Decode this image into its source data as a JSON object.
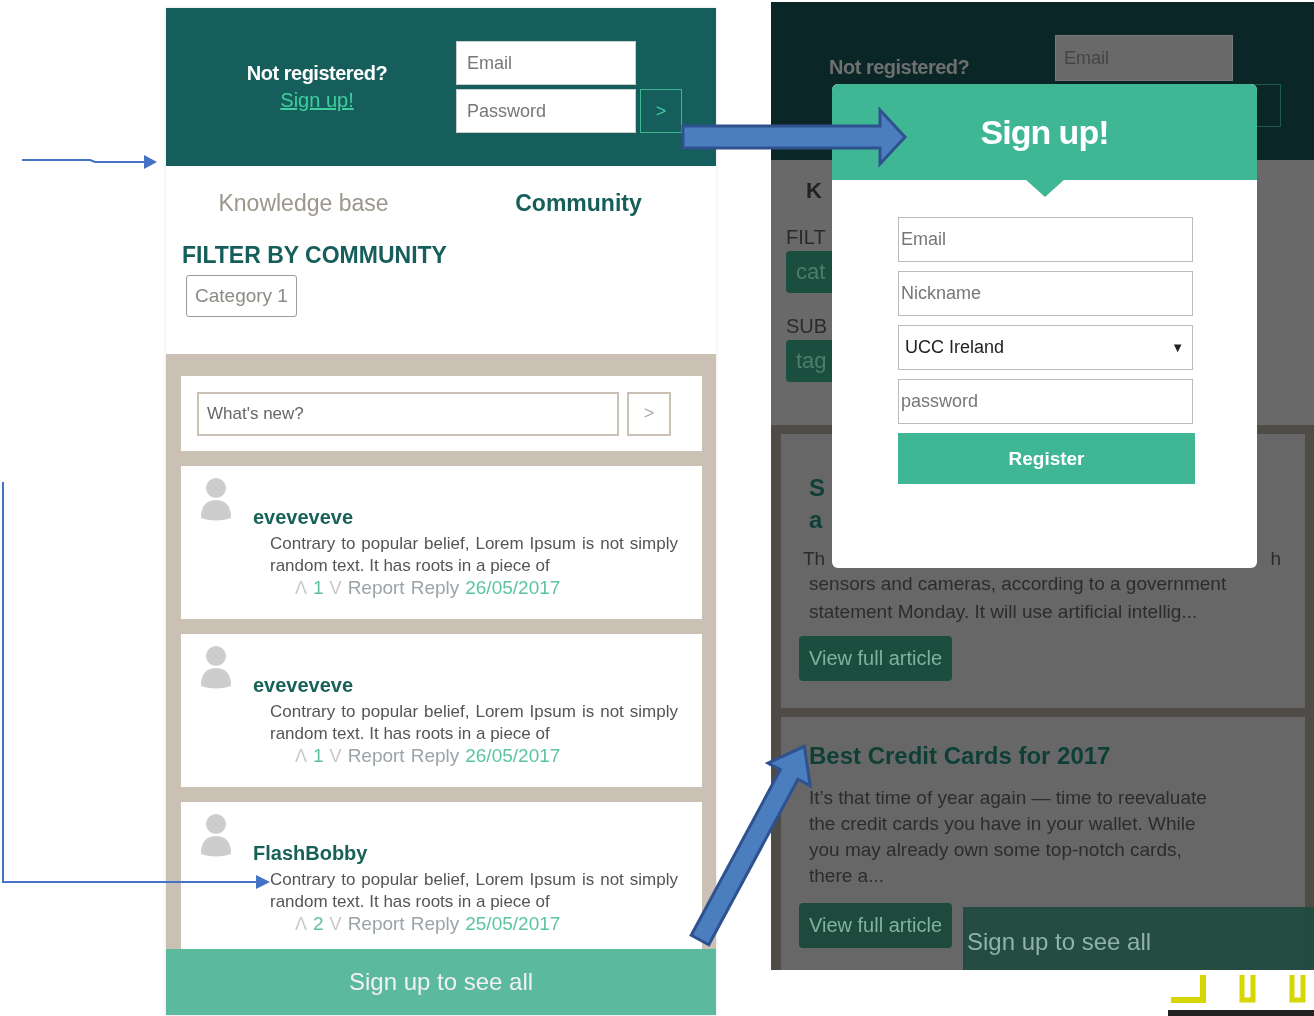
{
  "left_screen": {
    "header": {
      "question": "Not registered?",
      "link": "Sign up!",
      "email_placeholder": "Email",
      "password_placeholder": "Password",
      "submit": ">"
    },
    "tabs": [
      {
        "label": "Knowledge base",
        "selected": false
      },
      {
        "label": "Community",
        "selected": true
      }
    ],
    "filter": {
      "title": "FILTER BY COMMUNITY",
      "chips": [
        "Category 1"
      ]
    },
    "composer": {
      "placeholder": "What's new?",
      "submit": ">"
    },
    "posts": [
      {
        "author": "eveveveve",
        "body": "Contrary to popular belief, Lorem Ipsum is not simply random text. It has roots in a piece of",
        "vote_up": "Λ",
        "votes": "1",
        "vote_down": "V",
        "report": "Report",
        "reply": "Reply",
        "date": "26/05/2017"
      },
      {
        "author": "eveveveve",
        "body": "Contrary to popular belief, Lorem Ipsum is not simply random text. It has roots in a piece of",
        "vote_up": "Λ",
        "votes": "1",
        "vote_down": "V",
        "report": "Report",
        "reply": "Reply",
        "date": "26/05/2017"
      },
      {
        "author": "FlashBobby",
        "body": "Contrary to popular belief, Lorem Ipsum is not simply random text. It has roots in a piece of",
        "vote_up": "Λ",
        "votes": "2",
        "vote_down": "V",
        "report": "Report",
        "reply": "Reply",
        "date": "25/05/2017"
      }
    ],
    "footer": "Sign up to see all"
  },
  "right_screen": {
    "header": {
      "question": "Not registered?",
      "email_placeholder": "Email"
    },
    "fragments": {
      "tab": "K",
      "filter_label": "FILT",
      "filter_chip": "cat",
      "sub_label": "SUB",
      "sub_chip": "tag"
    },
    "articles": [
      {
        "title_lines": [
          "S",
          "a"
        ],
        "cut_line": {
          "start": "Th",
          "end": "h"
        },
        "body_lines": [
          "sensors and cameras, according to a government",
          "statement Monday. It will use artificial intellig..."
        ],
        "button": "View full article"
      },
      {
        "title_lines": [
          "Best Credit Cards for 2017"
        ],
        "body_lines": [
          "It’s that time of year again — time to reevaluate",
          "the credit cards you have in your wallet. While",
          "you may already own some top-notch cards,",
          "there a..."
        ],
        "button": "View full article"
      }
    ],
    "footer": "Sign up to see all",
    "modal": {
      "title": "Sign up!",
      "fields": [
        {
          "kind": "text",
          "placeholder": "Email"
        },
        {
          "kind": "text",
          "placeholder": "Nickname"
        },
        {
          "kind": "select",
          "value": "UCC Ireland",
          "caret": "▼"
        },
        {
          "kind": "text",
          "placeholder": "password"
        }
      ],
      "button": "Register"
    }
  }
}
